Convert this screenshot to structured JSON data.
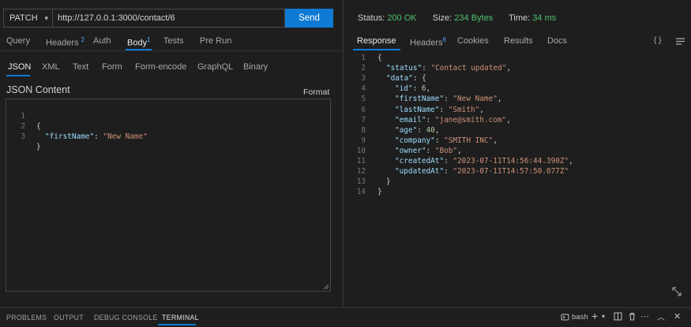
{
  "request": {
    "method": "PATCH",
    "url": "http://127.0.0.1:3000/contact/6",
    "send_label": "Send",
    "tabs": [
      {
        "label": "Query",
        "badge": ""
      },
      {
        "label": "Headers",
        "badge": "2"
      },
      {
        "label": "Auth",
        "badge": ""
      },
      {
        "label": "Body",
        "badge": "1"
      },
      {
        "label": "Tests",
        "badge": ""
      },
      {
        "label": "Pre Run",
        "badge": ""
      }
    ],
    "body_tabs": [
      "JSON",
      "XML",
      "Text",
      "Form",
      "Form-encode",
      "GraphQL",
      "Binary"
    ],
    "json_content_title": "JSON Content",
    "format_label": "Format",
    "body_lines": [
      {
        "num": "1",
        "text": "{"
      },
      {
        "num": "2",
        "key": "\"firstName\"",
        "sep": ": ",
        "value": "\"New Name\""
      },
      {
        "num": "3",
        "text": "}"
      }
    ]
  },
  "response": {
    "status_label": "Status:",
    "status_value": "200 OK",
    "size_label": "Size:",
    "size_value": "234 Bytes",
    "time_label": "Time:",
    "time_value": "34 ms",
    "tabs": [
      {
        "label": "Response",
        "badge": ""
      },
      {
        "label": "Headers",
        "badge": "6"
      },
      {
        "label": "Cookies",
        "badge": ""
      },
      {
        "label": "Results",
        "badge": ""
      },
      {
        "label": "Docs",
        "badge": ""
      }
    ],
    "braces_icon": "{ }",
    "lines": [
      {
        "num": "1",
        "indent": 0,
        "pre": "{"
      },
      {
        "num": "2",
        "indent": 1,
        "key": "\"status\"",
        "value": "\"Contact updated\"",
        "type": "s",
        "post": ","
      },
      {
        "num": "3",
        "indent": 1,
        "key": "\"data\"",
        "pre_after": "{"
      },
      {
        "num": "4",
        "indent": 2,
        "key": "\"id\"",
        "value": "6",
        "type": "n",
        "post": ","
      },
      {
        "num": "5",
        "indent": 2,
        "key": "\"firstName\"",
        "value": "\"New Name\"",
        "type": "s",
        "post": ","
      },
      {
        "num": "6",
        "indent": 2,
        "key": "\"lastName\"",
        "value": "\"Smith\"",
        "type": "s",
        "post": ","
      },
      {
        "num": "7",
        "indent": 2,
        "key": "\"email\"",
        "value": "\"jane@smith.com\"",
        "type": "s",
        "post": ","
      },
      {
        "num": "8",
        "indent": 2,
        "key": "\"age\"",
        "value": "40",
        "type": "n",
        "post": ","
      },
      {
        "num": "9",
        "indent": 2,
        "key": "\"company\"",
        "value": "\"SMITH INC\"",
        "type": "s",
        "post": ","
      },
      {
        "num": "10",
        "indent": 2,
        "key": "\"owner\"",
        "value": "\"Bob\"",
        "type": "s",
        "post": ","
      },
      {
        "num": "11",
        "indent": 2,
        "key": "\"createdAt\"",
        "value": "\"2023-07-11T14:56:44.390Z\"",
        "type": "s",
        "post": ","
      },
      {
        "num": "12",
        "indent": 2,
        "key": "\"updatedAt\"",
        "value": "\"2023-07-11T14:57:50.077Z\"",
        "type": "s",
        "post": ""
      },
      {
        "num": "13",
        "indent": 1,
        "pre": "}"
      },
      {
        "num": "14",
        "indent": 0,
        "pre": "}"
      }
    ]
  },
  "panel": {
    "tabs": [
      "PROBLEMS",
      "OUTPUT",
      "DEBUG CONSOLE",
      "TERMINAL"
    ],
    "active_tab": "TERMINAL",
    "shell_label": "bash"
  }
}
